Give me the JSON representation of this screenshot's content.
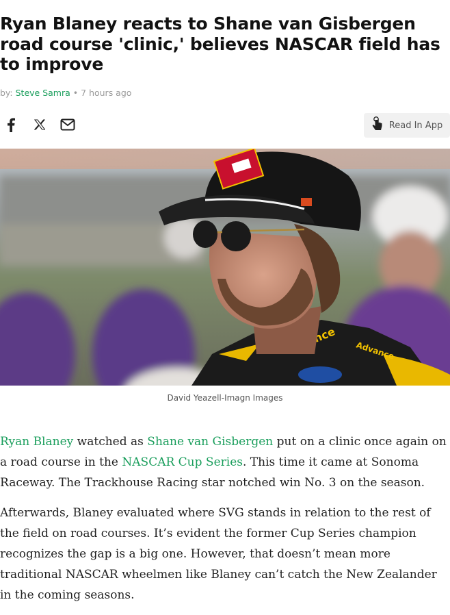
{
  "article": {
    "headline": "Ryan Blaney reacts to Shane van Gisbergen road course 'clinic,' believes NASCAR field has to improve",
    "byline_prefix": "by:",
    "author": "Steve Samra",
    "separator": "•",
    "time_ago": "7 hours ago",
    "photo_caption": "David Yeazell-Imagn Images"
  },
  "share": {
    "facebook_icon": "facebook-icon",
    "x_icon": "x-icon",
    "email_icon": "email-icon",
    "read_in_app_label": "Read In App"
  },
  "body": {
    "p1": {
      "link1": "Ryan Blaney",
      "t1": " watched as ",
      "link2": "Shane van Gisbergen",
      "t2": " put on a clinic once again on a road course in the ",
      "link3": "NASCAR Cup Series",
      "t3": ". This time it came at Sonoma Raceway. The Trackhouse Racing star notched win No. 3 on the season."
    },
    "p2": "Afterwards, Blaney evaluated where SVG stands in relation to the rest of the field on road courses. It’s evident the former Cup Series champion recognizes the gap is a big one. However, that doesn’t mean more traditional NASCAR wheelmen like Blaney can’t catch the New Zealander in the coming seasons."
  },
  "colors": {
    "link_green": "#1a9e5c",
    "cap_patch_red": "#c8102e",
    "suit_yellow": "#f2c200"
  }
}
